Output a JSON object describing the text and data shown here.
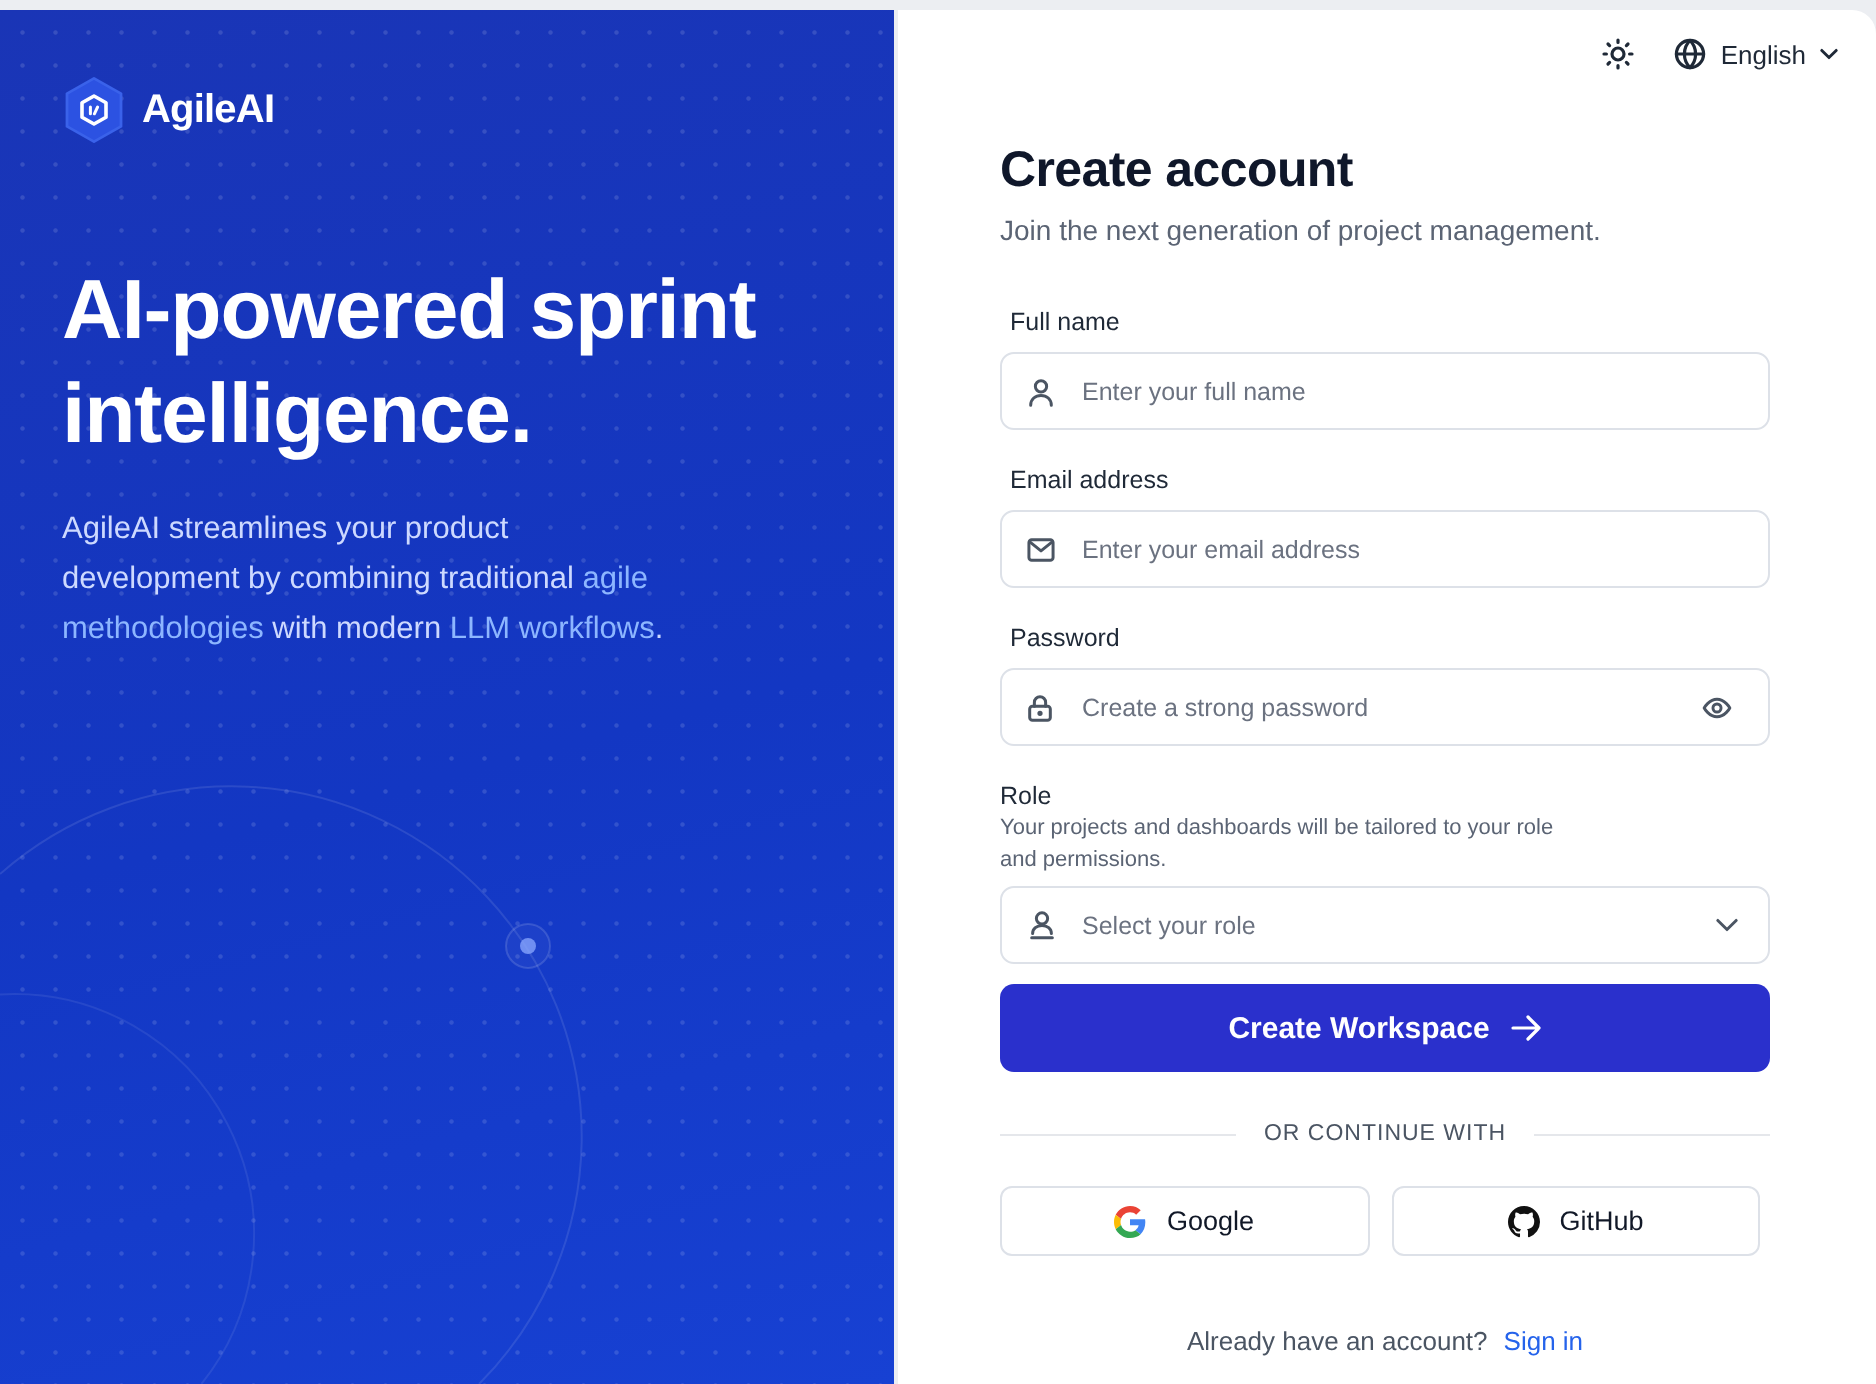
{
  "brand": {
    "name": "AgileAI"
  },
  "hero": {
    "headline": "AI-powered sprint intelligence.",
    "description": [
      {
        "text": "AgileAI streamlines your product development by combining traditional ",
        "highlight": false
      },
      {
        "text": "agile methodologies",
        "highlight": true
      },
      {
        "text": " with modern ",
        "highlight": false
      },
      {
        "text": "LLM workflows",
        "highlight": true
      },
      {
        "text": ".",
        "highlight": false
      }
    ]
  },
  "toolbar": {
    "language": "English"
  },
  "form": {
    "title": "Create account",
    "subtitle": "Join the next generation of project management.",
    "fields": [
      {
        "kind": "text",
        "label": "Full name",
        "placeholder": "Enter your full name"
      },
      {
        "kind": "email",
        "label": "Email address",
        "placeholder": "Enter your email address"
      },
      {
        "kind": "password",
        "label": "Password",
        "placeholder": "Create a strong password"
      },
      {
        "kind": "select",
        "label": "Role",
        "help": "Your projects and dashboards will be tailored to your role and permissions.",
        "placeholder": "Select your role"
      }
    ],
    "submit": {
      "label": "Create Workspace"
    },
    "divider": "OR CONTINUE WITH",
    "social": [
      {
        "kind": "google",
        "label": "Google"
      },
      {
        "kind": "github",
        "label": "GitHub"
      }
    ],
    "footer": {
      "prompt": "Already have an account?",
      "link": "Sign in"
    }
  }
}
